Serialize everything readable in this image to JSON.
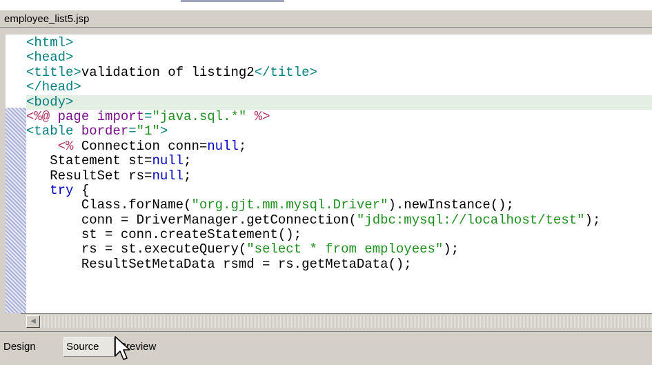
{
  "window": {
    "title": "employee_list5.jsp"
  },
  "editor": {
    "lines": [
      {
        "tokens": [
          {
            "t": "<html>",
            "c": "tg"
          }
        ]
      },
      {
        "tokens": [
          {
            "t": "<head>",
            "c": "tg"
          }
        ]
      },
      {
        "tokens": [
          {
            "t": "<title>",
            "c": "tg"
          },
          {
            "t": "validation of listing2"
          },
          {
            "t": "</title>",
            "c": "tg"
          }
        ]
      },
      {
        "tokens": [
          {
            "t": "</head>",
            "c": "tg"
          }
        ]
      },
      {
        "tokens": [
          {
            "t": "<body>",
            "c": "tg"
          }
        ],
        "highlight": true
      },
      {
        "tokens": [
          {
            "t": "<%@",
            "c": "dr"
          },
          {
            "t": " page ",
            "c": "at"
          },
          {
            "t": "import",
            "c": "at"
          },
          {
            "t": "=",
            "c": "tg"
          },
          {
            "t": "\"java.sql.*\"",
            "c": "st"
          },
          {
            "t": " %>",
            "c": "dr"
          }
        ]
      },
      {
        "tokens": [
          {
            "t": "<table ",
            "c": "tg"
          },
          {
            "t": "border",
            "c": "at"
          },
          {
            "t": "=",
            "c": "tg"
          },
          {
            "t": "\"1\"",
            "c": "st"
          },
          {
            "t": ">",
            "c": "tg"
          }
        ]
      },
      {
        "tokens": [
          {
            "t": "    "
          },
          {
            "t": "<%",
            "c": "dr"
          },
          {
            "t": " Connection conn="
          },
          {
            "t": "null",
            "c": "kw"
          },
          {
            "t": ";"
          }
        ]
      },
      {
        "tokens": [
          {
            "t": "   Statement st="
          },
          {
            "t": "null",
            "c": "kw"
          },
          {
            "t": ";"
          }
        ]
      },
      {
        "tokens": [
          {
            "t": "   ResultSet rs="
          },
          {
            "t": "null",
            "c": "kw"
          },
          {
            "t": ";"
          }
        ]
      },
      {
        "tokens": [
          {
            "t": "   "
          },
          {
            "t": "try",
            "c": "kw"
          },
          {
            "t": " {"
          }
        ]
      },
      {
        "tokens": [
          {
            "t": "       Class.forName("
          },
          {
            "t": "\"org.gjt.mm.mysql.Driver\"",
            "c": "st"
          },
          {
            "t": ").newInstance();"
          }
        ]
      },
      {
        "tokens": [
          {
            "t": "       conn = DriverManager.getConnection("
          },
          {
            "t": "\"jdbc:mysql://localhost/test\"",
            "c": "st"
          },
          {
            "t": ");"
          }
        ]
      },
      {
        "tokens": [
          {
            "t": "       st = conn.createStatement();"
          }
        ]
      },
      {
        "tokens": [
          {
            "t": "       rs = st.executeQuery("
          },
          {
            "t": "\"select * from employees\"",
            "c": "st"
          },
          {
            "t": ");"
          }
        ]
      },
      {
        "tokens": [
          {
            "t": "       ResultSetMetaData rsmd = rs.getMetaData();"
          }
        ]
      }
    ]
  },
  "scrollbar": {
    "left_arrow_icon": "triangle-left-icon",
    "left_arrow_glyph": "◀"
  },
  "tabs": {
    "design": "Design",
    "source": "Source",
    "preview": "Preview",
    "active": "source"
  },
  "colors": {
    "tag": "#008080",
    "directive": "#b03060",
    "attribute": "#7a0f8a",
    "string": "#1f8f1f",
    "keyword": "#0000c8",
    "current_line": "#e3efe3"
  }
}
